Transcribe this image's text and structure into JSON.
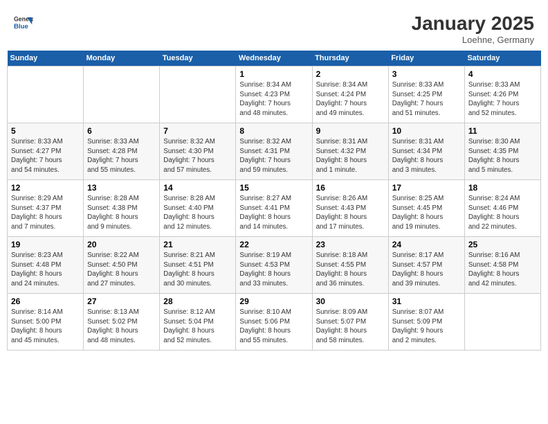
{
  "header": {
    "logo_line1": "General",
    "logo_line2": "Blue",
    "title": "January 2025",
    "subtitle": "Loehne, Germany"
  },
  "days": [
    "Sunday",
    "Monday",
    "Tuesday",
    "Wednesday",
    "Thursday",
    "Friday",
    "Saturday"
  ],
  "weeks": [
    [
      {
        "date": "",
        "info": ""
      },
      {
        "date": "",
        "info": ""
      },
      {
        "date": "",
        "info": ""
      },
      {
        "date": "1",
        "info": "Sunrise: 8:34 AM\nSunset: 4:23 PM\nDaylight: 7 hours\nand 48 minutes."
      },
      {
        "date": "2",
        "info": "Sunrise: 8:34 AM\nSunset: 4:24 PM\nDaylight: 7 hours\nand 49 minutes."
      },
      {
        "date": "3",
        "info": "Sunrise: 8:33 AM\nSunset: 4:25 PM\nDaylight: 7 hours\nand 51 minutes."
      },
      {
        "date": "4",
        "info": "Sunrise: 8:33 AM\nSunset: 4:26 PM\nDaylight: 7 hours\nand 52 minutes."
      }
    ],
    [
      {
        "date": "5",
        "info": "Sunrise: 8:33 AM\nSunset: 4:27 PM\nDaylight: 7 hours\nand 54 minutes."
      },
      {
        "date": "6",
        "info": "Sunrise: 8:33 AM\nSunset: 4:28 PM\nDaylight: 7 hours\nand 55 minutes."
      },
      {
        "date": "7",
        "info": "Sunrise: 8:32 AM\nSunset: 4:30 PM\nDaylight: 7 hours\nand 57 minutes."
      },
      {
        "date": "8",
        "info": "Sunrise: 8:32 AM\nSunset: 4:31 PM\nDaylight: 7 hours\nand 59 minutes."
      },
      {
        "date": "9",
        "info": "Sunrise: 8:31 AM\nSunset: 4:32 PM\nDaylight: 8 hours\nand 1 minute."
      },
      {
        "date": "10",
        "info": "Sunrise: 8:31 AM\nSunset: 4:34 PM\nDaylight: 8 hours\nand 3 minutes."
      },
      {
        "date": "11",
        "info": "Sunrise: 8:30 AM\nSunset: 4:35 PM\nDaylight: 8 hours\nand 5 minutes."
      }
    ],
    [
      {
        "date": "12",
        "info": "Sunrise: 8:29 AM\nSunset: 4:37 PM\nDaylight: 8 hours\nand 7 minutes."
      },
      {
        "date": "13",
        "info": "Sunrise: 8:28 AM\nSunset: 4:38 PM\nDaylight: 8 hours\nand 9 minutes."
      },
      {
        "date": "14",
        "info": "Sunrise: 8:28 AM\nSunset: 4:40 PM\nDaylight: 8 hours\nand 12 minutes."
      },
      {
        "date": "15",
        "info": "Sunrise: 8:27 AM\nSunset: 4:41 PM\nDaylight: 8 hours\nand 14 minutes."
      },
      {
        "date": "16",
        "info": "Sunrise: 8:26 AM\nSunset: 4:43 PM\nDaylight: 8 hours\nand 17 minutes."
      },
      {
        "date": "17",
        "info": "Sunrise: 8:25 AM\nSunset: 4:45 PM\nDaylight: 8 hours\nand 19 minutes."
      },
      {
        "date": "18",
        "info": "Sunrise: 8:24 AM\nSunset: 4:46 PM\nDaylight: 8 hours\nand 22 minutes."
      }
    ],
    [
      {
        "date": "19",
        "info": "Sunrise: 8:23 AM\nSunset: 4:48 PM\nDaylight: 8 hours\nand 24 minutes."
      },
      {
        "date": "20",
        "info": "Sunrise: 8:22 AM\nSunset: 4:50 PM\nDaylight: 8 hours\nand 27 minutes."
      },
      {
        "date": "21",
        "info": "Sunrise: 8:21 AM\nSunset: 4:51 PM\nDaylight: 8 hours\nand 30 minutes."
      },
      {
        "date": "22",
        "info": "Sunrise: 8:19 AM\nSunset: 4:53 PM\nDaylight: 8 hours\nand 33 minutes."
      },
      {
        "date": "23",
        "info": "Sunrise: 8:18 AM\nSunset: 4:55 PM\nDaylight: 8 hours\nand 36 minutes."
      },
      {
        "date": "24",
        "info": "Sunrise: 8:17 AM\nSunset: 4:57 PM\nDaylight: 8 hours\nand 39 minutes."
      },
      {
        "date": "25",
        "info": "Sunrise: 8:16 AM\nSunset: 4:58 PM\nDaylight: 8 hours\nand 42 minutes."
      }
    ],
    [
      {
        "date": "26",
        "info": "Sunrise: 8:14 AM\nSunset: 5:00 PM\nDaylight: 8 hours\nand 45 minutes."
      },
      {
        "date": "27",
        "info": "Sunrise: 8:13 AM\nSunset: 5:02 PM\nDaylight: 8 hours\nand 48 minutes."
      },
      {
        "date": "28",
        "info": "Sunrise: 8:12 AM\nSunset: 5:04 PM\nDaylight: 8 hours\nand 52 minutes."
      },
      {
        "date": "29",
        "info": "Sunrise: 8:10 AM\nSunset: 5:06 PM\nDaylight: 8 hours\nand 55 minutes."
      },
      {
        "date": "30",
        "info": "Sunrise: 8:09 AM\nSunset: 5:07 PM\nDaylight: 8 hours\nand 58 minutes."
      },
      {
        "date": "31",
        "info": "Sunrise: 8:07 AM\nSunset: 5:09 PM\nDaylight: 9 hours\nand 2 minutes."
      },
      {
        "date": "",
        "info": ""
      }
    ]
  ]
}
